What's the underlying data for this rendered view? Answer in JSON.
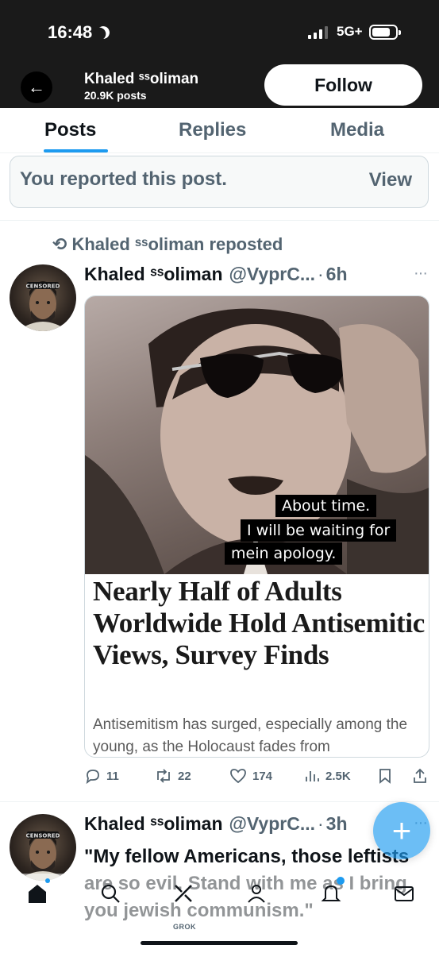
{
  "status_bar": {
    "time": "16:48",
    "network": "5G+"
  },
  "header": {
    "name": "Khaled ˢˢoliman",
    "posts_count": "20.9K posts",
    "follow_label": "Follow"
  },
  "tabs": [
    {
      "label": "Posts",
      "active": true
    },
    {
      "label": "Replies",
      "active": false
    },
    {
      "label": "Media",
      "active": false
    }
  ],
  "reported_notice": {
    "text": "You reported this post.",
    "action": "View"
  },
  "post1": {
    "reposted_by": "Khaled ˢˢoliman reposted",
    "author_name": "Khaled ˢˢoliman",
    "handle": "@VyprC...",
    "time": "6h",
    "avatar_label": "CENSORED",
    "meme_caption": [
      "About time.",
      "I will be waiting for",
      "mein apology."
    ],
    "article_headline": "Nearly Half of Adults Worldwide Hold Antisemitic Views, Survey Finds",
    "article_dek": "Antisemitism has surged, especially among the young, as the Holocaust fades from",
    "stats": {
      "replies": "11",
      "reposts": "22",
      "likes": "174",
      "views": "2.5K"
    }
  },
  "post2": {
    "author_name": "Khaled ˢˢoliman",
    "handle": "@VyprC...",
    "time": "3h",
    "avatar_label": "CENSORED",
    "text": "\"My fellow Americans, those leftists are so evil. Stand with me as I bring you jewish communism.\""
  },
  "bottom_nav": {
    "grok_label": "GROK"
  },
  "colors": {
    "accent": "#1d9bf0",
    "text_primary": "#0f1419",
    "text_secondary": "#536471",
    "header_bg": "#1a1a1a"
  }
}
